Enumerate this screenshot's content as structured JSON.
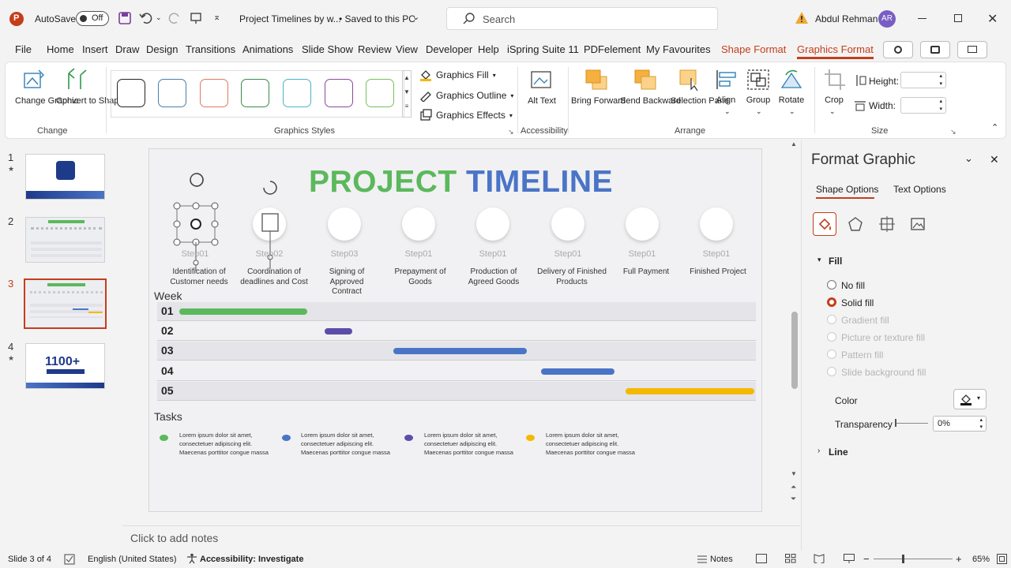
{
  "titlebar": {
    "autosave_label": "AutoSave",
    "autosave_state": "Off",
    "doc_title": "Project Timelines by w...",
    "save_status": "• Saved to this PC",
    "search_placeholder": "Search",
    "user_name": "Abdul Rehman",
    "user_initials": "AR"
  },
  "menu": {
    "items": [
      "File",
      "Home",
      "Insert",
      "Draw",
      "Design",
      "Transitions",
      "Animations",
      "Slide Show",
      "Review",
      "View",
      "Developer",
      "Help",
      "iSpring Suite 11",
      "PDFelement",
      "My Favourites",
      "Shape Format",
      "Graphics Format"
    ]
  },
  "ribbon": {
    "change": {
      "change_graphic": "Change Graphic",
      "convert": "Convert to Shape",
      "group": "Change"
    },
    "styles": {
      "group": "Graphics Styles",
      "colors": [
        "#222222",
        "#4b7ea8",
        "#e07a5f",
        "#3a8a4a",
        "#4bb3c4",
        "#8a4a9c",
        "#7abf5c"
      ]
    },
    "cmds": {
      "fill": "Graphics Fill",
      "outline": "Graphics Outline",
      "effects": "Graphics Effects"
    },
    "accessibility": {
      "alt_text": "Alt Text",
      "group": "Accessibility"
    },
    "arrange": {
      "bring": "Bring Forward",
      "send": "Send Backward",
      "selection": "Selection Pane",
      "align": "Align",
      "group_btn": "Group",
      "rotate": "Rotate",
      "group": "Arrange"
    },
    "size": {
      "crop": "Crop",
      "height": "Height:",
      "width": "Width:",
      "group": "Size"
    }
  },
  "thumbnails": [
    {
      "num": "1"
    },
    {
      "num": "2"
    },
    {
      "num": "3"
    },
    {
      "num": "4"
    }
  ],
  "slide": {
    "title_a": "PROJECT",
    "title_b": "TIMELINE",
    "steps": [
      {
        "label": "Step01",
        "desc": "Identification of Customer needs"
      },
      {
        "label": "Step02",
        "desc": "Coordination of deadlines and Cost"
      },
      {
        "label": "Step03",
        "desc": "Signing of Approved Contract"
      },
      {
        "label": "Step01",
        "desc": "Prepayment of Goods"
      },
      {
        "label": "Step01",
        "desc": "Production of Agreed Goods"
      },
      {
        "label": "Step01",
        "desc": "Delivery of Finished Products"
      },
      {
        "label": "Step01",
        "desc": "Full Payment"
      },
      {
        "label": "Step01",
        "desc": "Finished Project"
      }
    ],
    "week_heading": "Week",
    "weeks": [
      "01",
      "02",
      "03",
      "04",
      "05"
    ],
    "tasks_heading": "Tasks",
    "task_text": "Lorem ipsum dolor sit amet, consectetuer adipiscing elit. Maecenas porttitor congue massa",
    "colors": {
      "green": "#5cb85c",
      "purple": "#5b4ea8",
      "blue": "#4a74c6",
      "yellow": "#f5b800"
    }
  },
  "notes": {
    "placeholder": "Click to add notes"
  },
  "status": {
    "slide": "Slide 3 of 4",
    "language": "English (United States)",
    "accessibility": "Accessibility: Investigate",
    "notes": "Notes",
    "zoom": "65%"
  },
  "pane": {
    "title": "Format Graphic",
    "tab_shape": "Shape Options",
    "tab_text": "Text Options",
    "fill": "Fill",
    "options": [
      "No fill",
      "Solid fill",
      "Gradient fill",
      "Picture or texture fill",
      "Pattern fill",
      "Slide background fill"
    ],
    "color": "Color",
    "transparency": "Transparency",
    "transparency_value": "0%",
    "line": "Line"
  }
}
